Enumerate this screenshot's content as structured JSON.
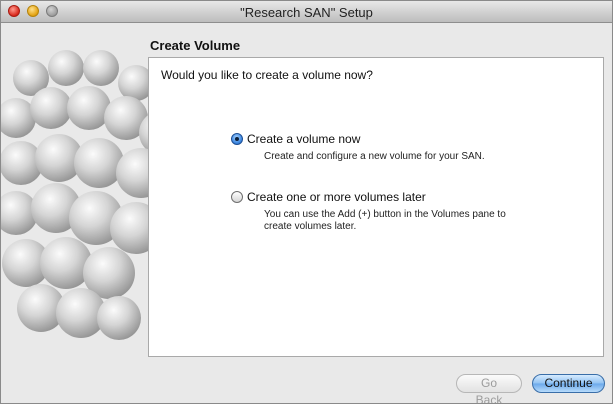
{
  "window": {
    "title": "\"Research SAN\" Setup"
  },
  "page": {
    "section_title": "Create Volume",
    "question": "Would you like to create a volume now?"
  },
  "options": [
    {
      "label": "Create a volume now",
      "description": "Create and configure a new volume for your SAN.",
      "selected": true
    },
    {
      "label": "Create one or more volumes later",
      "description": "You can use the Add (+) button in the Volumes pane to create volumes later.",
      "selected": false
    }
  ],
  "buttons": {
    "back_label": "Go Back",
    "back_enabled": false,
    "continue_label": "Continue"
  },
  "colors": {
    "accent": "#3b86e0",
    "window_bg": "#e9e9e9",
    "panel_bg": "#ffffff"
  }
}
